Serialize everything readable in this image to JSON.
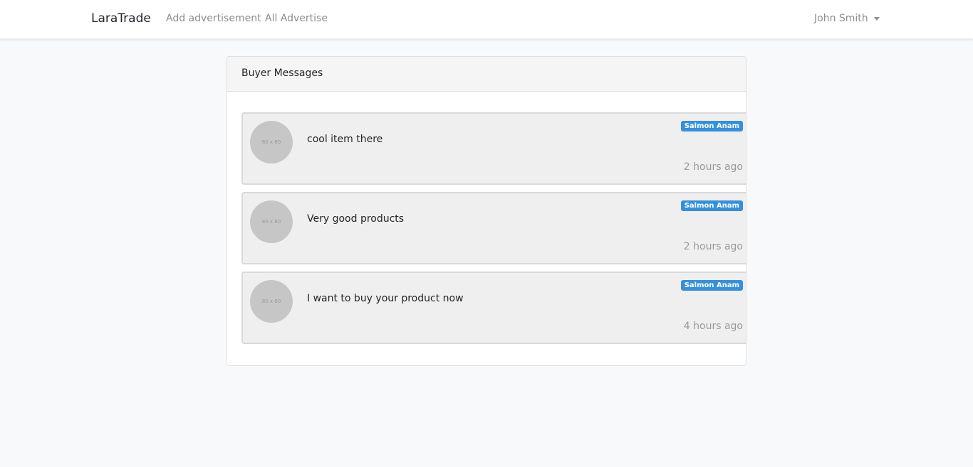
{
  "navbar": {
    "brand": "LaraTrade",
    "links": [
      "Add advertisement",
      "All Advertise"
    ],
    "user": "John Smith"
  },
  "card": {
    "title": "Buyer Messages",
    "messages": [
      {
        "avatar": "80 x 80",
        "text": "cool item there",
        "sender": "Salmon Anam",
        "time": "2 hours ago"
      },
      {
        "avatar": "80 x 80",
        "text": "Very good products",
        "sender": "Salmon Anam",
        "time": "2 hours ago"
      },
      {
        "avatar": "80 x 80",
        "text": "I want to buy your product now",
        "sender": "Salmon Anam",
        "time": "4 hours ago"
      }
    ]
  },
  "colors": {
    "accent": "#3490dc",
    "background": "#f8f9fa"
  }
}
